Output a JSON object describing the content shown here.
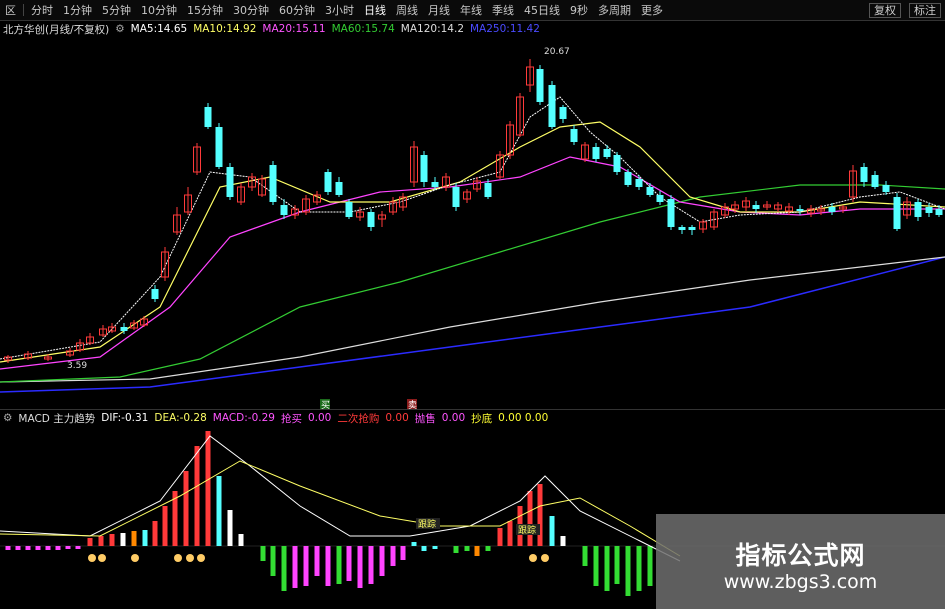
{
  "toolbar": {
    "items": [
      "区",
      "分时",
      "1分钟",
      "5分钟",
      "10分钟",
      "15分钟",
      "30分钟",
      "60分钟",
      "3小时",
      "日线",
      "周线",
      "月线",
      "年线",
      "季线",
      "45日线",
      "9秒",
      "多周期",
      "更多"
    ],
    "right": [
      "复权",
      "标注"
    ]
  },
  "info": {
    "title": "北方华创(月线/不复权)",
    "ma5": "MA5:14.65",
    "ma10": "MA10:14.92",
    "ma20": "MA20:15.11",
    "ma60": "MA60:15.74",
    "ma120": "MA120:14.2",
    "ma250": "MA250:11.42"
  },
  "price_labels": {
    "high": "20.67",
    "low": "3.59"
  },
  "indicator": {
    "name": "MACD 主力趋势",
    "dif": "DIF:-0.31",
    "dea": "DEA:-0.28",
    "macd": "MACD:-0.29",
    "buy_label": "抢买",
    "buy_value": "0.00",
    "second_label": "二次抢购",
    "second_value": "0.00",
    "sell_label": "抛售",
    "sell_value": "0.00",
    "bottom_label": "抄底",
    "bottom_value": "0.00 0.00",
    "tags": [
      "跟踪",
      "跟踪"
    ]
  },
  "markers": {
    "buy": "买",
    "sell": "卖"
  },
  "watermark": {
    "title": "指标公式网",
    "url": "www.zbgs3.com"
  },
  "colors": {
    "up": "#ff3a3a",
    "down": "#54ffff",
    "ma5": "#ffffff",
    "ma10": "#ffff66",
    "ma20": "#ff44ff",
    "ma60": "#33cc33",
    "ma120": "#dddddd",
    "ma250": "#2b2bff",
    "macd_green": "#33dd33",
    "macd_magenta": "#ff44ff"
  }
}
